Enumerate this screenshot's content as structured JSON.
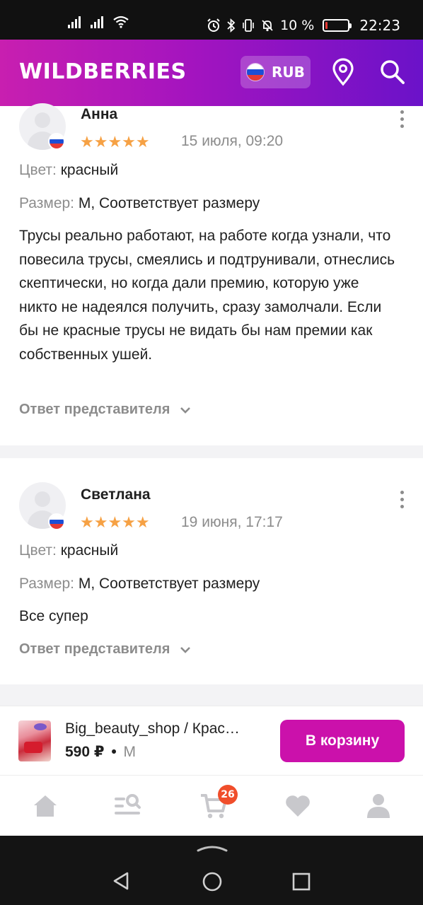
{
  "status_bar": {
    "battery_text": "10 %",
    "battery_level": 0.1,
    "time": "22:23"
  },
  "header": {
    "logo": "WILDBERRIES",
    "currency": "RUB",
    "brand_colors": {
      "gradient_start": "#c81fb0",
      "gradient_end": "#6b12c9"
    },
    "icons": [
      "location-pin-icon",
      "search-icon"
    ]
  },
  "reviews": [
    {
      "author": "Анна",
      "rating": 5,
      "stars": "★★★★★",
      "date": "15 июля, 09:20",
      "color_label": "Цвет:",
      "color_value": "красный",
      "size_label": "Размер:",
      "size_value": "M, Соответствует размеру",
      "text": "Трусы реально работают, на работе когда узнали, что повесила трусы, смеялись и подтрунивали, отнеслись скептически, но когда дали премию, которую уже никто не надеялся получить, сразу замолчали. Если бы не красные трусы не видать бы нам премии как собственных ушей.",
      "answer_label": "Ответ представителя"
    },
    {
      "author": "Светлана",
      "rating": 5,
      "stars": "★★★★★",
      "date": "19 июня, 17:17",
      "color_label": "Цвет:",
      "color_value": "красный",
      "size_label": "Размер:",
      "size_value": "M, Соответствует размеру",
      "text": "Все супер",
      "answer_label": "Ответ представителя"
    }
  ],
  "product_bar": {
    "name": "Big_beauty_shop / Крас…",
    "price": "590 ₽",
    "separator": "•",
    "size": "M",
    "cart_button": "В корзину",
    "button_color": "#cb11ab"
  },
  "bottom_nav": {
    "items": [
      "home-icon",
      "catalog-search-icon",
      "cart-icon",
      "favorites-heart-icon",
      "profile-icon"
    ],
    "cart_badge": "26",
    "badge_color": "#f04e2b"
  },
  "system_nav": [
    "back-icon",
    "home-circle-icon",
    "recents-icon"
  ]
}
